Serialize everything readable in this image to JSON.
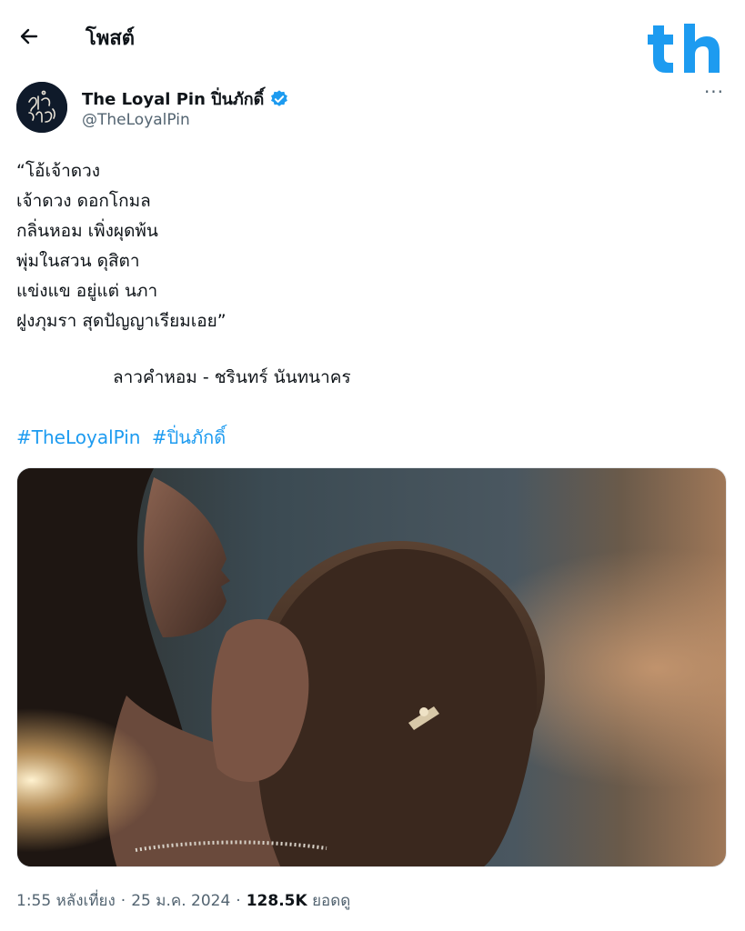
{
  "header": {
    "back_icon": "arrow-left-icon",
    "title": "โพสต์",
    "brand_logo_text": "th",
    "brand_color": "#1d9bf0"
  },
  "author": {
    "display_name": "The Loyal Pin ปิ่นภักดิ์",
    "handle": "@TheLoyalPin",
    "verified_icon": "verified-badge-icon",
    "verified_color": "#1d9bf0",
    "more_label": "···"
  },
  "post": {
    "lines": [
      "“โอ้เจ้าดวง",
      "เจ้าดวง ดอกโกมล",
      "กลิ่นหอม เพิ่งผุดพ้น",
      "พุ่มในสวน ดุสิตา",
      "แข่งแข อยู่แต่ นภา",
      "ฝูงภุมรา สุดปัญญาเรียมเอย”"
    ],
    "credit": "ลาวคำหอม - ชรินทร์ นันทนาคร",
    "hashtags": [
      "#TheLoyalPin",
      "#ปิ่นภักดิ์"
    ],
    "hashtag_color": "#1d9bf0"
  },
  "meta": {
    "time": "1:55 หลังเที่ยง",
    "date": "25 ม.ค. 2024",
    "views_count": "128.5K",
    "views_label": "ยอดดู"
  }
}
